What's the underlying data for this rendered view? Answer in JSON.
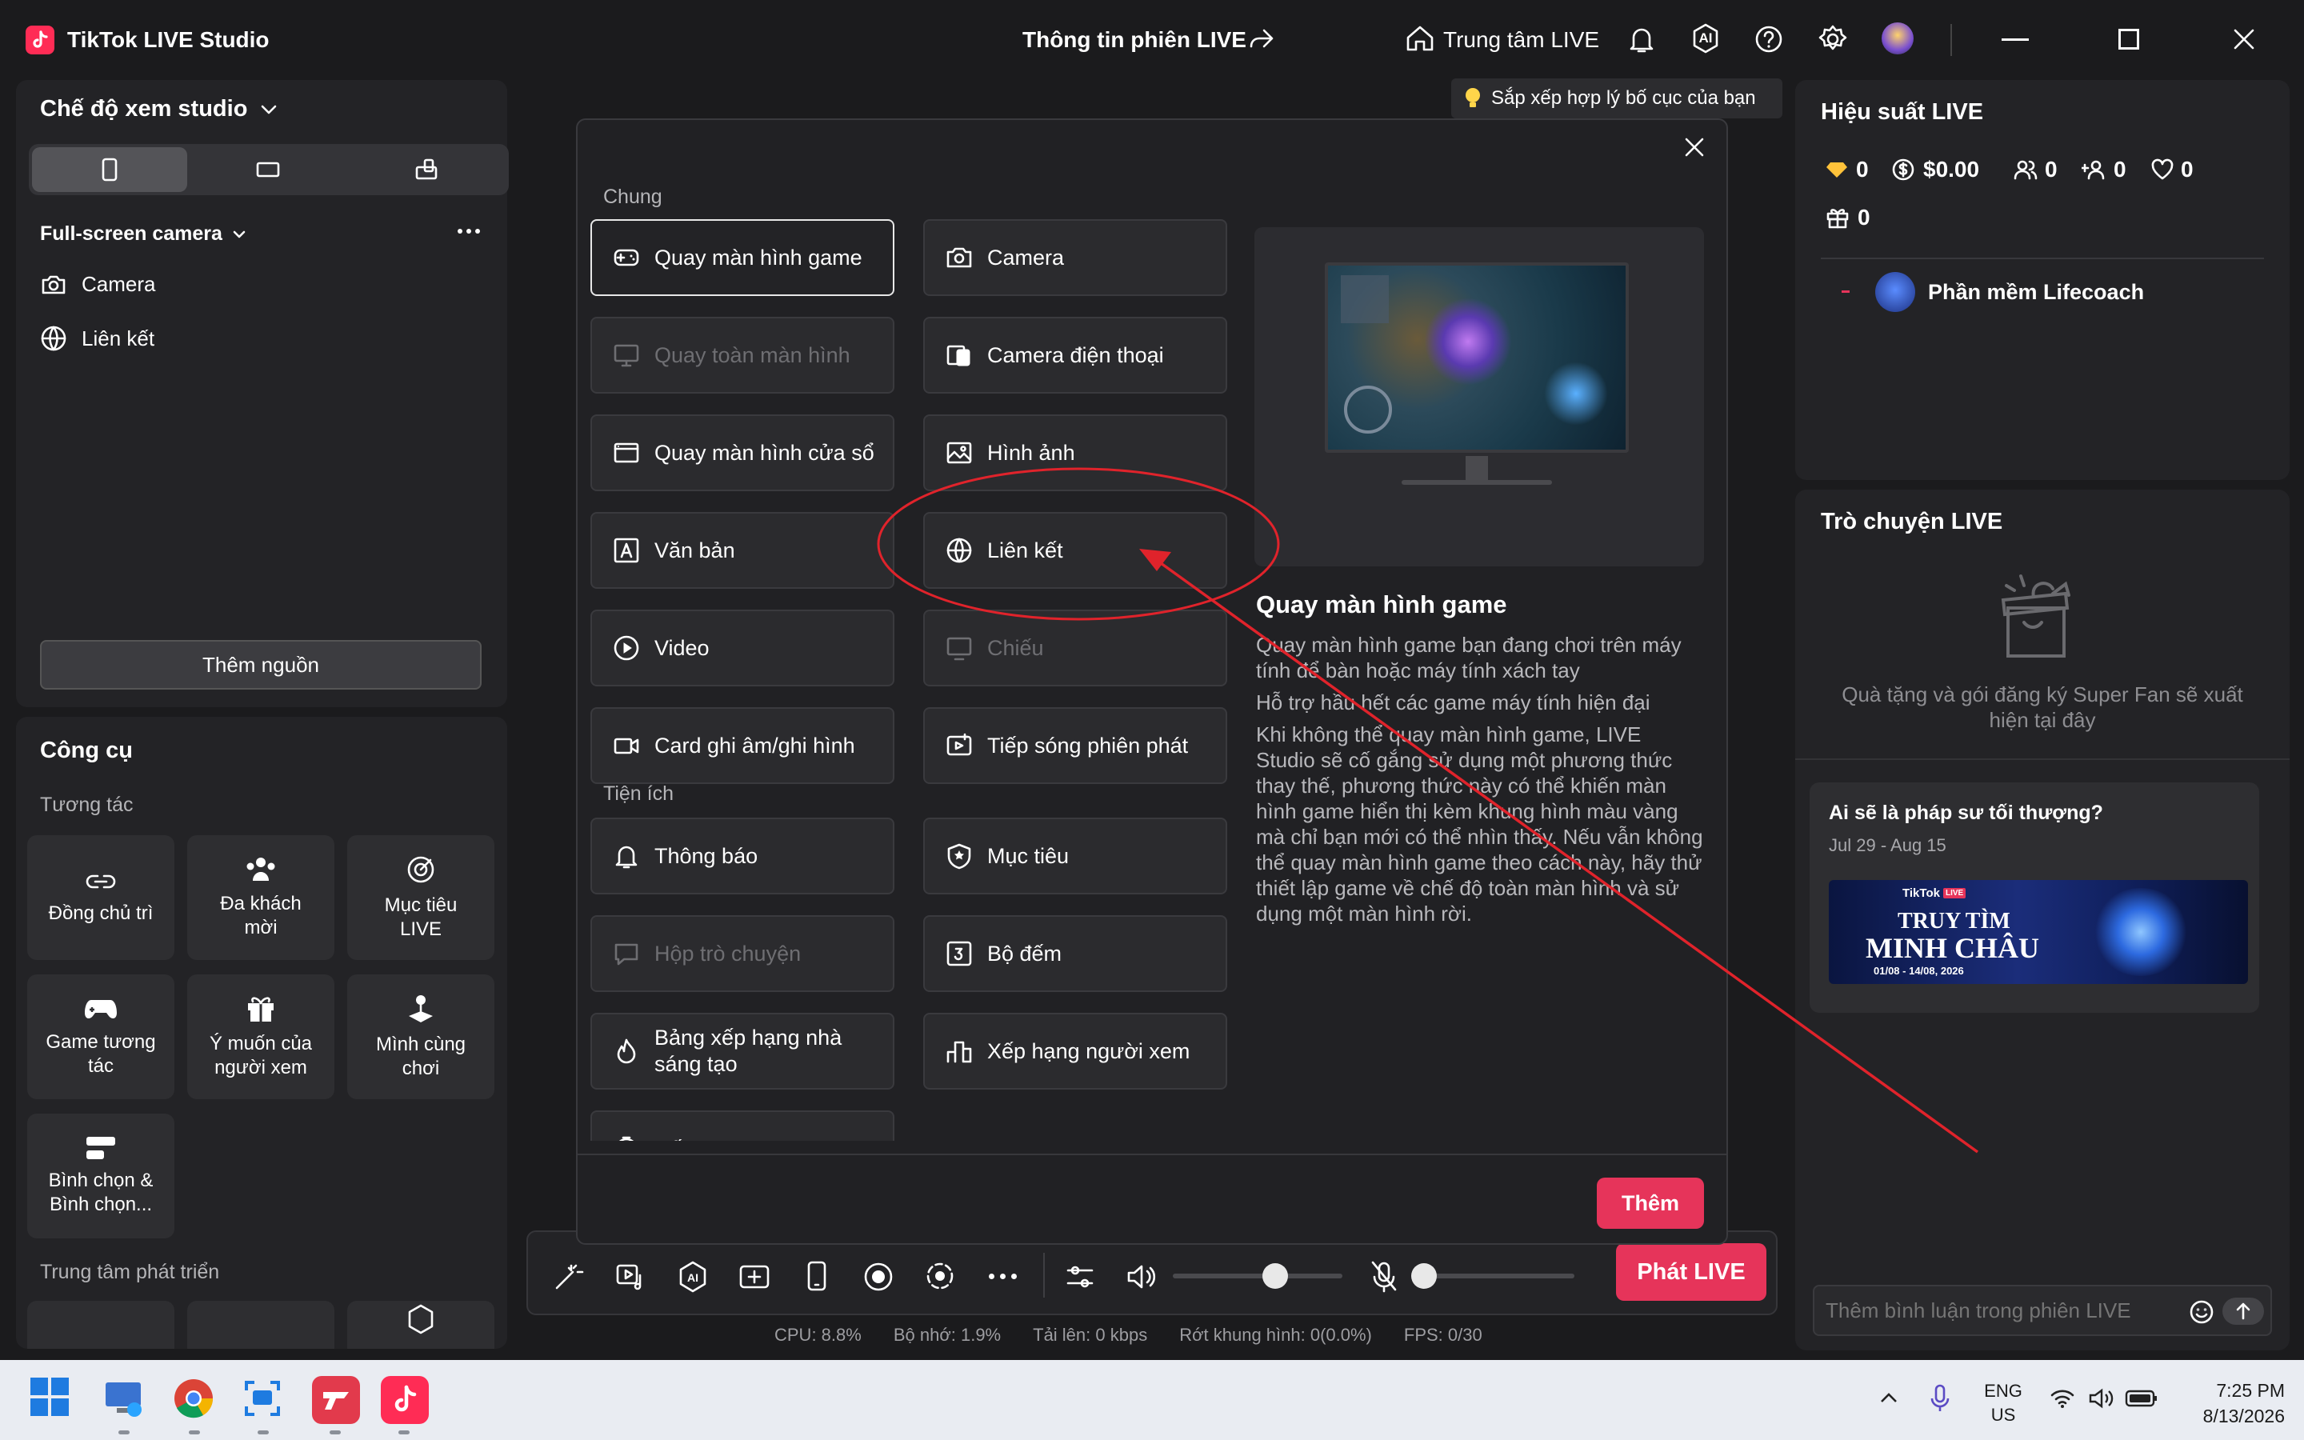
{
  "window": {
    "app_name": "TikTok LIVE Studio",
    "center_title": "Thông tin phiên LIVE",
    "live_center_label": "Trung tâm LIVE",
    "ai_label": "AI"
  },
  "left_panel": {
    "studio_view_title": "Chế độ xem studio",
    "scene_name": "Full-screen camera",
    "sources": [
      "Camera",
      "Liên kết"
    ],
    "add_source_button": "Thêm nguồn",
    "tools_title": "Công cụ",
    "interaction_label": "Tương tác",
    "tools": [
      {
        "label": "Đồng chủ trì",
        "icon": "link-icon"
      },
      {
        "label": "Đa khách mời",
        "icon": "multi-guest-icon"
      },
      {
        "label": "Mục tiêu LIVE",
        "icon": "target-icon"
      },
      {
        "label": "Game tương tác",
        "icon": "gamepad-icon"
      },
      {
        "label": "Ý muốn của người xem",
        "icon": "gift-icon"
      },
      {
        "label": "Mình cùng chơi",
        "icon": "joystick-icon"
      },
      {
        "label": "Bình chọn & Bình chọn...",
        "icon": "poll-icon"
      }
    ],
    "dev_center_label": "Trung tâm phát triển"
  },
  "tip_banner": "Sắp xếp hợp lý bố cục của bạn",
  "modal": {
    "section_general": "Chung",
    "section_utilities": "Tiện ích",
    "general_sources": [
      {
        "label": "Quay màn hình game",
        "icon": "gamepad-icon",
        "state": "selected"
      },
      {
        "label": "Camera",
        "icon": "camera-icon",
        "state": "normal"
      },
      {
        "label": "Quay toàn màn hình",
        "icon": "monitor-icon",
        "state": "disabled"
      },
      {
        "label": "Camera điện thoại",
        "icon": "phone-camera-icon",
        "state": "normal"
      },
      {
        "label": "Quay màn hình cửa sổ",
        "icon": "window-icon",
        "state": "normal"
      },
      {
        "label": "Hình ảnh",
        "icon": "image-icon",
        "state": "normal"
      },
      {
        "label": "Văn bản",
        "icon": "text-icon",
        "state": "normal"
      },
      {
        "label": "Liên kết",
        "icon": "globe-icon",
        "state": "normal"
      },
      {
        "label": "Video",
        "icon": "play-icon",
        "state": "normal"
      },
      {
        "label": "Chiếu",
        "icon": "cast-icon",
        "state": "disabled"
      },
      {
        "label": "Card ghi âm/ghi hình",
        "icon": "video-camera-icon",
        "state": "normal"
      },
      {
        "label": "Tiếp sóng phiên phát",
        "icon": "relay-icon",
        "state": "normal"
      }
    ],
    "utility_sources": [
      {
        "label": "Thông báo",
        "icon": "bell-icon",
        "state": "normal"
      },
      {
        "label": "Mục tiêu",
        "icon": "shield-star-icon",
        "state": "normal"
      },
      {
        "label": "Hộp trò chuyện",
        "icon": "chat-icon",
        "state": "disabled"
      },
      {
        "label": "Bộ đếm",
        "icon": "counter-icon",
        "state": "normal"
      },
      {
        "label": "Bảng xếp hạng nhà sáng tạo",
        "icon": "flame-icon",
        "state": "normal"
      },
      {
        "label": "Xếp hạng người xem",
        "icon": "ranking-icon",
        "state": "normal"
      },
      {
        "label": "Đếm ngược",
        "icon": "timer-icon",
        "state": "normal"
      }
    ],
    "preview_title": "Quay màn hình game",
    "preview_paragraphs": [
      "Quay màn hình game bạn đang chơi trên máy tính để bàn hoặc máy tính xách tay",
      "Hỗ trợ hầu hết các game máy tính hiện đại",
      "Khi không thể quay màn hình game, LIVE Studio sẽ cố gắng sử dụng một phương thức thay thế, phương thức này có thể khiến màn hình game hiển thị kèm khung hình màu vàng mà chỉ bạn mới có thể nhìn thấy. Nếu vẫn không thể quay màn hình game theo cách này, hãy thử thiết lập game về chế độ toàn màn hình và sử dụng một màn hình rời."
    ],
    "add_button": "Thêm"
  },
  "bottom_bar": {
    "go_live_button": "Phát LIVE",
    "stats": {
      "cpu": "CPU:  8.8%",
      "memory": "Bộ nhớ:  1.9%",
      "upload": "Tải lên:  0 kbps",
      "dropped": "Rớt khung hình:  0(0.0%)",
      "fps": "FPS:  0/30"
    }
  },
  "right_panel": {
    "performance_title": "Hiệu suất LIVE",
    "stats": [
      {
        "icon": "diamond-icon",
        "value": "0"
      },
      {
        "icon": "dollar-icon",
        "value": "$0.00"
      },
      {
        "icon": "viewers-icon",
        "value": "0"
      },
      {
        "icon": "new-follower-icon",
        "value": "0"
      },
      {
        "icon": "heart-icon",
        "value": "0"
      },
      {
        "icon": "gift-icon",
        "value": "0"
      }
    ],
    "software_label": "Phần mềm Lifecoach",
    "chat_title": "Trò chuyện LIVE",
    "chat_empty_text": "Quà tặng và gói đăng ký Super Fan sẽ xuất hiện tại đây",
    "event_title": "Ai sẽ là pháp sư tối thượng?",
    "event_dates": "Jul 29 - Aug 15",
    "event_banner_brand": "TikTok",
    "event_banner_brand_tag": "LIVE",
    "event_banner_line1": "TRUY TÌM",
    "event_banner_line2": "MINH CHÂU",
    "event_banner_dates": "01/08 - 14/08, 2026",
    "comment_placeholder": "Thêm bình luận trong phiên LIVE"
  },
  "taskbar": {
    "lang_line1": "ENG",
    "lang_line2": "US",
    "time": "7:25 PM",
    "date": "8/13/2026"
  },
  "colors": {
    "accent": "#e6345a",
    "annotation": "#e0232b",
    "background": "#1b1b1d",
    "panel": "#232326"
  }
}
